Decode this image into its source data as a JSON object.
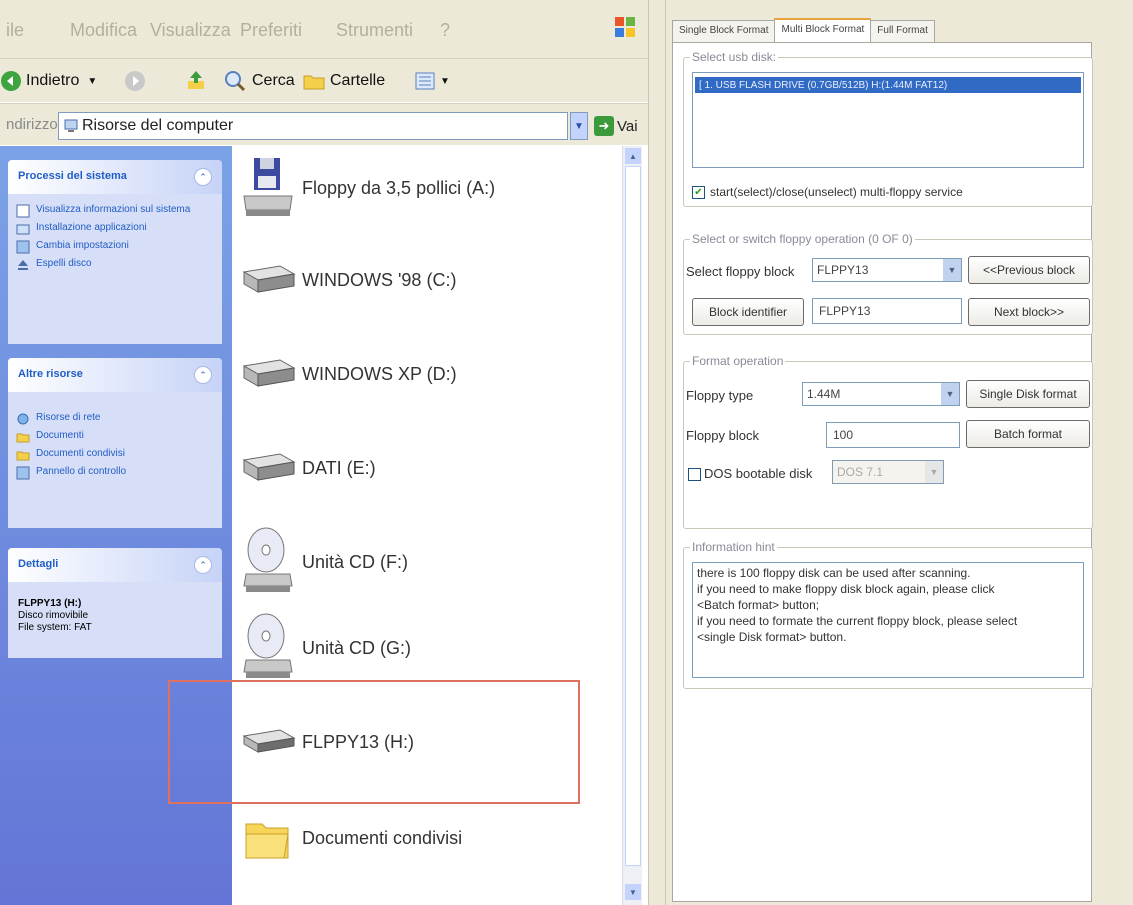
{
  "explorer": {
    "menu": [
      "ile",
      "Modifica",
      "Visualizza",
      "Preferiti",
      "Strumenti",
      "?"
    ],
    "toolbar": {
      "back": "Indietro",
      "search": "Cerca",
      "folders": "Cartelle"
    },
    "address": {
      "label": "ndirizzo",
      "value": "Risorse del computer",
      "go": "Vai"
    },
    "panels": {
      "system": {
        "title": "Processi del sistema",
        "items": [
          "Visualizza informazioni sul sistema",
          "Installazione applicazioni",
          "Cambia impostazioni",
          "Espelli disco"
        ]
      },
      "other": {
        "title": "Altre risorse",
        "items": [
          "Risorse di rete",
          "Documenti",
          "Documenti condivisi",
          "Pannello di controllo"
        ]
      },
      "details": {
        "title": "Dettagli",
        "name": "FLPPY13 (H:)",
        "type": "Disco rimovibile",
        "fs": "File system: FAT"
      }
    },
    "files": [
      {
        "label": "Floppy da 3,5 pollici (A:)",
        "icon": "floppy-drive-icon"
      },
      {
        "label": "WINDOWS '98 (C:)",
        "icon": "hard-drive-icon"
      },
      {
        "label": "WINDOWS XP (D:)",
        "icon": "hard-drive-icon"
      },
      {
        "label": "DATI (E:)",
        "icon": "hard-drive-icon"
      },
      {
        "label": "Unità CD (F:)",
        "icon": "cd-drive-icon"
      },
      {
        "label": "Unità CD (G:)",
        "icon": "cd-drive-icon"
      },
      {
        "label": "FLPPY13 (H:)",
        "icon": "removable-drive-icon"
      },
      {
        "label": "Documenti condivisi",
        "icon": "folder-icon"
      }
    ]
  },
  "tool": {
    "tabs": [
      "Single Block Format",
      "Multi Block Format",
      "Full Format"
    ],
    "active_tab": "Multi Block Format",
    "disk_group": {
      "title": "Select usb disk:",
      "selected": "[ 1. USB FLASH DRIVE (0.7GB/512B) H:(1.44M FAT12)",
      "checkbox_label": "start(select)/close(unselect) multi-floppy service",
      "checked": true
    },
    "switch_group": {
      "title": "Select or switch floppy operation (0 OF 0)",
      "select_label": "Select floppy block",
      "select_value": "FLPPY13",
      "prev_button": "<<Previous block",
      "identifier_button": "Block identifier",
      "identifier_value": "FLPPY13",
      "next_button": "Next block>>"
    },
    "format_group": {
      "title": "Format operation",
      "type_label": "Floppy type",
      "type_value": "1.44M",
      "single_button": "Single Disk format",
      "block_label": "Floppy block",
      "block_value": "100",
      "batch_button": "Batch format",
      "dos_label": "DOS bootable disk",
      "dos_value": "DOS 7.1",
      "dos_checked": false
    },
    "info_group": {
      "title": "Information hint",
      "lines": [
        "there is 100 floppy disk can be used after scanning.",
        " if you need to make floppy disk block again, please click",
        "<Batch format> button;",
        " if you need to formate the current floppy block, please select",
        "<single Disk format> button."
      ]
    }
  },
  "colors": {
    "highlight_box": "#e07060",
    "selection": "#316ac5",
    "sidebar": "#6c8ce0"
  }
}
